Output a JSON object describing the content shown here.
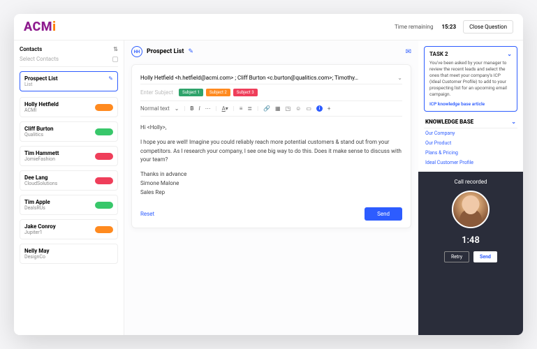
{
  "brand": {
    "part1": "ACM",
    "part2": "i"
  },
  "header": {
    "time_label": "Time remaining",
    "time_value": "15:23",
    "close": "Close Question"
  },
  "sidebar": {
    "title": "Contacts",
    "select": "Select Contacts",
    "list_card": {
      "title": "Prospect List",
      "sub": "List"
    },
    "contacts": [
      {
        "name": "Holly Hetfield",
        "company": "ACMI",
        "pill": "p-orange"
      },
      {
        "name": "Cliff Burton",
        "company": "Qualitics",
        "pill": "p-green"
      },
      {
        "name": "Tim Hammett",
        "company": "JomieFashion",
        "pill": "p-red"
      },
      {
        "name": "Dee Lang",
        "company": "CloudSolutions",
        "pill": "p-red"
      },
      {
        "name": "Tim Apple",
        "company": "DealsRUs",
        "pill": "p-green"
      },
      {
        "name": "Jake Conroy",
        "company": "Jupiter1",
        "pill": "p-orange"
      },
      {
        "name": "Nelly May",
        "company": "DesignCo",
        "pill": ""
      }
    ]
  },
  "crumb": {
    "initials": "HH",
    "title": "Prospect List"
  },
  "compose": {
    "to": "Holly Hetfield <h.hetfield@acmi.com> ; Cliff Burton <c.burton@qualitics.com>; Timothy…",
    "subject_ph": "Enter Subject",
    "tags": [
      "Subject 1",
      "Subject 2",
      "Subject 3"
    ],
    "format_label": "Normal text",
    "greeting": "Hi <Holly>,",
    "para": "I hope you are well! Imagine you could reliably reach more potential customers & stand out from your competitors.  As I research your company, I see one big way to do this. Does it make sense to discuss with your team?",
    "sig1": "Thanks in advance",
    "sig2": "Simone Malone",
    "sig3": "Sales Rep",
    "reset": "Reset",
    "send": "Send"
  },
  "task": {
    "title": "TASK 2",
    "body": "You've been asked by your manager to review the recent leads and select the ones that meet your company's ICP (Ideal Customer Profile) to add to your prospecting list for an upcoming email campaign.",
    "link": "ICP knowledge base article"
  },
  "kb": {
    "title": "KNOWLEDGE BASE",
    "items": [
      "Our Company",
      "Our Product",
      "Plans & Pricing",
      "Ideal Customer Profile"
    ]
  },
  "call": {
    "title": "Call recorded",
    "time": "1:48",
    "retry": "Retry",
    "send": "Send"
  }
}
